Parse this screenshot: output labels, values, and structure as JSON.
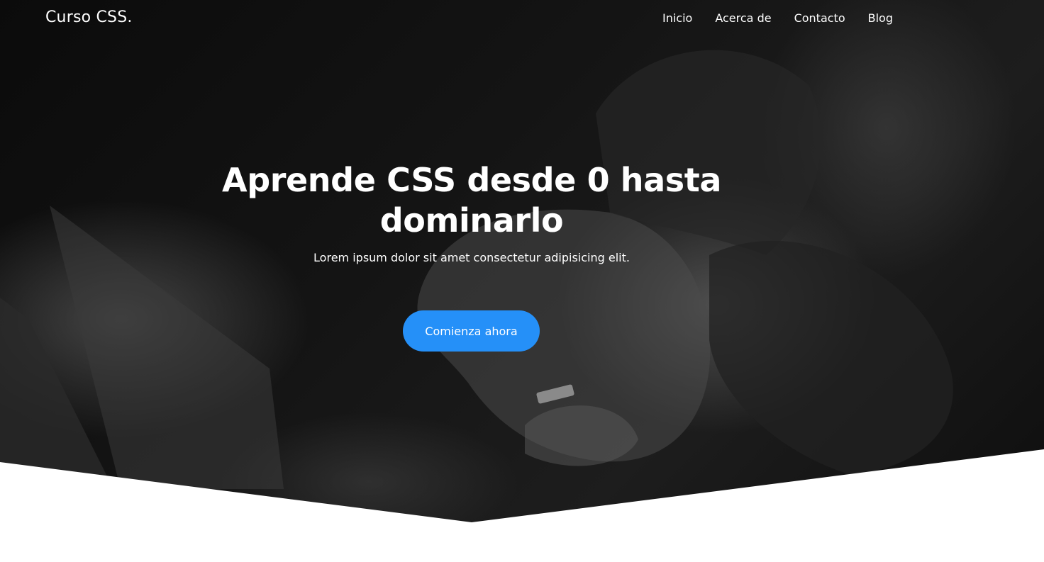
{
  "header": {
    "logo": "Curso CSS.",
    "nav": [
      {
        "label": "Inicio"
      },
      {
        "label": "Acerca de"
      },
      {
        "label": "Contacto"
      },
      {
        "label": "Blog"
      }
    ]
  },
  "hero": {
    "title": "Aprende CSS desde 0 hasta dominarlo",
    "subtitle": "Lorem ipsum dolor sit amet consectetur adipisicing elit.",
    "cta_label": "Comienza ahora",
    "background": "dark-photo-hands-laptop"
  },
  "colors": {
    "accent": "#2590f8",
    "text": "#ffffff",
    "page_bg": "#ffffff"
  }
}
